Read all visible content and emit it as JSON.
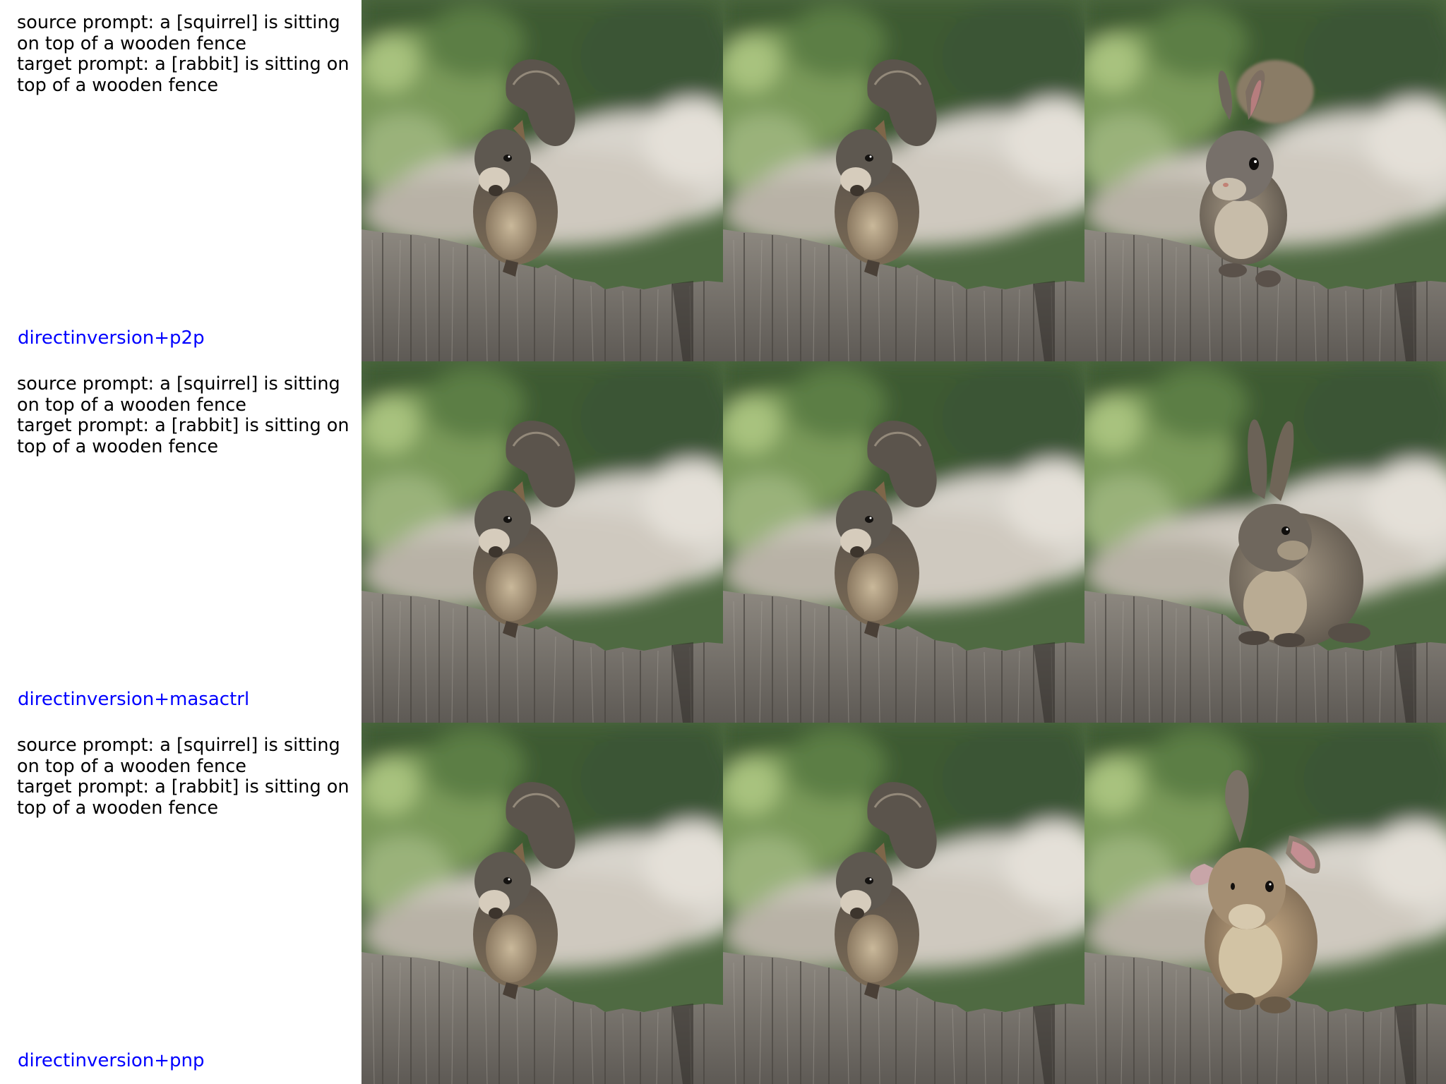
{
  "rows": [
    {
      "prompt_lines": [
        "source prompt: a [squirrel] is sitting",
        "on top of a wooden fence",
        "target prompt: a [rabbit] is sitting on",
        "top of a wooden fence"
      ],
      "method": "directinversion+p2p",
      "images": [
        "source squirrel photo",
        "reconstructed squirrel photo",
        "edited rabbit photo (ears up, partly merged with squirrel tail)"
      ]
    },
    {
      "prompt_lines": [
        "source prompt: a [squirrel] is sitting",
        "on top of a wooden fence",
        "target prompt: a [rabbit] is sitting on",
        "top of a wooden fence"
      ],
      "method": "directinversion+masactrl",
      "images": [
        "source squirrel photo",
        "reconstructed squirrel photo",
        "edited rabbit photo (side view, tall ears)"
      ]
    },
    {
      "prompt_lines": [
        "source prompt: a [squirrel] is sitting",
        "on top of a wooden fence",
        "target prompt: a [rabbit] is sitting on",
        "top of a wooden fence"
      ],
      "method": "directinversion+pnp",
      "images": [
        "source squirrel photo",
        "reconstructed squirrel photo",
        "edited rabbit photo (lop ears, front view)"
      ]
    }
  ],
  "colors": {
    "method_label": "#0000ff",
    "prompt_text": "#000000",
    "background": "#ffffff"
  }
}
